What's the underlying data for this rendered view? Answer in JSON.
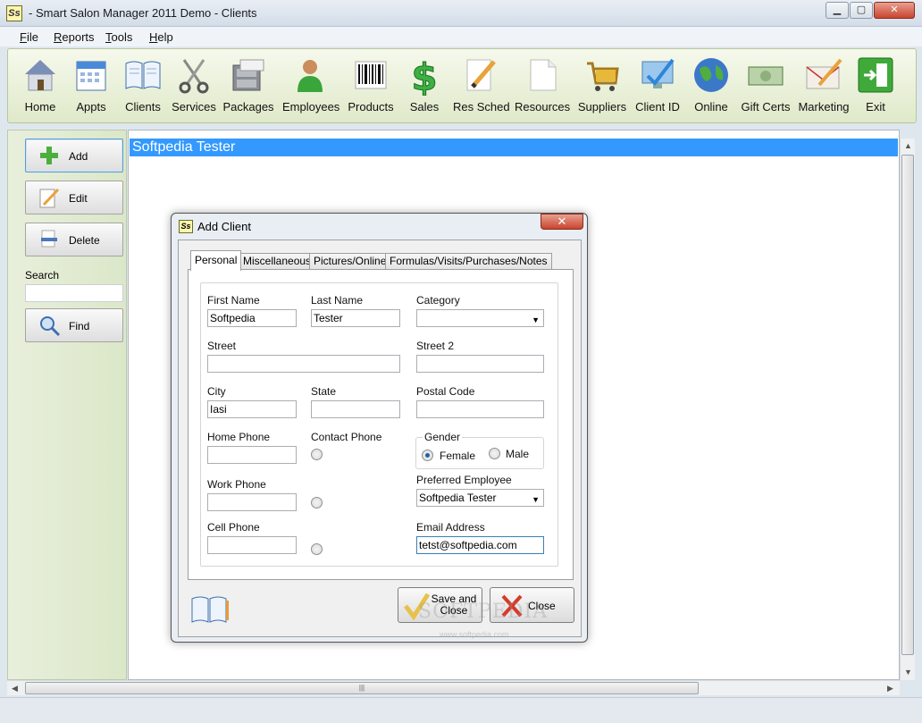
{
  "window": {
    "title": "- Smart Salon Manager 2011 Demo - Clients",
    "icon_text": "Ss"
  },
  "menu": [
    {
      "underline": "F",
      "rest": "ile"
    },
    {
      "underline": "R",
      "rest": "eports"
    },
    {
      "underline": "T",
      "rest": "ools"
    },
    {
      "underline": "H",
      "rest": "elp"
    }
  ],
  "toolbar": [
    {
      "label": "Home",
      "icon": "house-icon"
    },
    {
      "label": "Appts",
      "icon": "calendar-icon"
    },
    {
      "label": "Clients",
      "icon": "book-icon"
    },
    {
      "label": "Services",
      "icon": "scissors-icon"
    },
    {
      "label": "Packages",
      "icon": "file-cabinet-icon"
    },
    {
      "label": "Employees",
      "icon": "person-icon"
    },
    {
      "label": "Products",
      "icon": "barcode-icon"
    },
    {
      "label": "Sales",
      "icon": "dollar-icon"
    },
    {
      "label": "Res Sched",
      "icon": "pencil-paper-icon"
    },
    {
      "label": "Resources",
      "icon": "paper-icon"
    },
    {
      "label": "Suppliers",
      "icon": "cart-icon"
    },
    {
      "label": "Client ID",
      "icon": "monitor-check-icon"
    },
    {
      "label": "Online",
      "icon": "globe-icon"
    },
    {
      "label": "Gift Certs",
      "icon": "banknote-icon"
    },
    {
      "label": "Marketing",
      "icon": "envelope-pencil-icon"
    },
    {
      "label": "Exit",
      "icon": "exit-icon"
    }
  ],
  "sidebar": {
    "add_label": "Add",
    "edit_label": "Edit",
    "delete_label": "Delete",
    "search_label": "Search",
    "search_value": "",
    "find_label": "Find"
  },
  "list": {
    "selected_row": "Softpedia Tester"
  },
  "dialog": {
    "title": "Add Client",
    "icon_text": "Ss",
    "close_glyph": "✕",
    "tabs": [
      "Personal",
      "Miscellaneous",
      "Pictures/Online",
      "Formulas/Visits/Purchases/Notes"
    ],
    "fields": {
      "first_name_label": "First Name",
      "first_name_value": "Softpedia",
      "last_name_label": "Last Name",
      "last_name_value": "Tester",
      "category_label": "Category",
      "category_value": "",
      "street_label": "Street",
      "street_value": "",
      "street2_label": "Street 2",
      "street2_value": "",
      "city_label": "City",
      "city_value": "Iasi",
      "state_label": "State",
      "state_value": "",
      "postal_label": "Postal Code",
      "postal_value": "",
      "home_phone_label": "Home Phone",
      "home_phone_value": "",
      "contact_phone_label": "Contact Phone",
      "gender_label": "Gender",
      "female_label": "Female",
      "male_label": "Male",
      "gender_selected": "Female",
      "work_phone_label": "Work Phone",
      "work_phone_value": "",
      "pref_employee_label": "Preferred Employee",
      "pref_employee_value": "Softpedia Tester",
      "cell_phone_label": "Cell Phone",
      "cell_phone_value": "",
      "email_label": "Email Address",
      "email_value": "tetst@softpedia.com"
    },
    "save_label_1": "Save and",
    "save_label_2": "Close",
    "close_label": "Close"
  },
  "watermark": {
    "main": "SOFTPEDIA",
    "sub": "www.softpedia.com"
  },
  "colors": {
    "selection": "#3399ff",
    "toolbar_bg": "#e8f0d8",
    "accent": "#5b9bd1"
  }
}
